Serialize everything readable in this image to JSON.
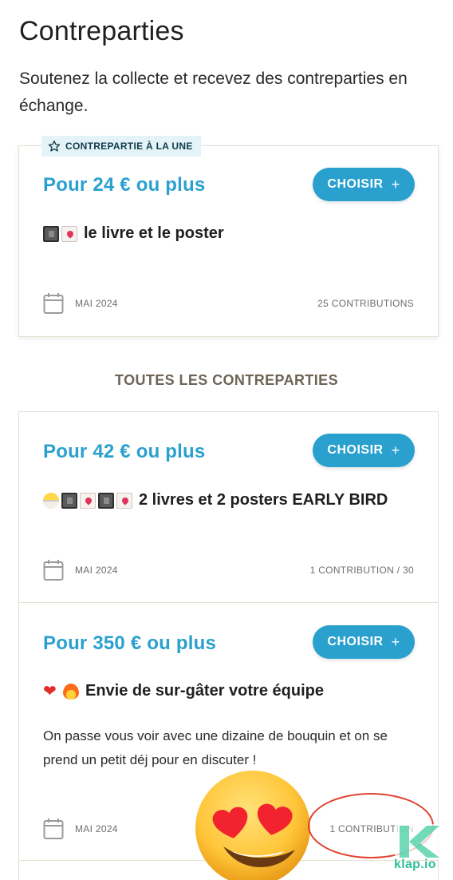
{
  "header": {
    "title": "Contreparties",
    "subtitle": "Soutenez la collecte et recevez des contreparties en échange."
  },
  "featured": {
    "badge_label": "CONTREPARTIE À LA UNE",
    "price": "Pour 24 € ou plus",
    "choose_label": "CHOISIR",
    "title": "le livre et le poster",
    "emojis": [
      "book-emoji",
      "love-letter-emoji"
    ],
    "date": "MAI 2024",
    "count": "25 CONTRIBUTIONS"
  },
  "section": {
    "heading": "TOUTES LES CONTREPARTIES"
  },
  "rewards": [
    {
      "price": "Pour 42 € ou plus",
      "choose_label": "CHOISIR",
      "title": "2 livres et 2 posters EARLY BIRD",
      "emojis": [
        "hatching-chick-emoji",
        "book-emoji",
        "love-letter-emoji",
        "book-emoji",
        "love-letter-emoji"
      ],
      "date": "MAI 2024",
      "count": "1 CONTRIBUTION / 30"
    },
    {
      "price": "Pour 350 € ou plus",
      "choose_label": "CHOISIR",
      "title": "Envie de sur-gâter votre équipe",
      "emojis": [
        "red-heart-emoji",
        "fire-emoji"
      ],
      "description": "On passe vous voir avec une dizaine de bouquin et on se prend un petit déj pour en discuter !",
      "date": "MAI 2024",
      "count": "1 CONTRIBUTION"
    }
  ],
  "overlay": {
    "sticker": "heart-eyes-emoji",
    "annotation_color": "#e0412f",
    "watermark_text": "klap.io"
  },
  "colors": {
    "accent": "#2aa0cf",
    "badge_bg": "#e4f3f7",
    "section_heading": "#6f6457",
    "card_border": "#e6dfd3"
  }
}
